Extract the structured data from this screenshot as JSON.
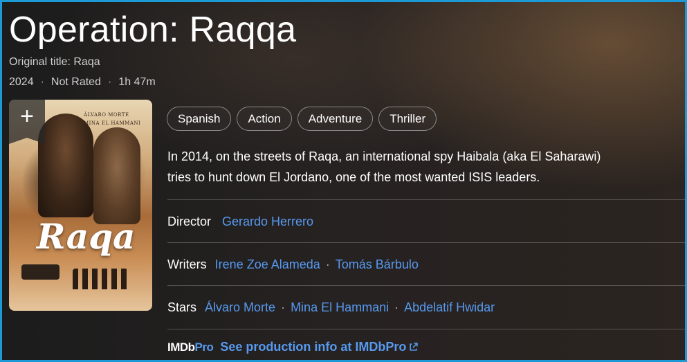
{
  "title": "Operation: Raqqa",
  "original_title": "Original title: Raqa",
  "meta": {
    "year": "2024",
    "rating": "Not Rated",
    "runtime": "1h 47m",
    "separator": "·"
  },
  "poster": {
    "logo_text": "Raqa",
    "credits": [
      "ÁLVARO MORTE",
      "MINA EL HAMMANI"
    ],
    "add_symbol": "+"
  },
  "genres": [
    "Spanish",
    "Action",
    "Adventure",
    "Thriller"
  ],
  "plot": {
    "line1": "In 2014, on the streets of Raqa, an international spy Haibala (aka El Saharawi)",
    "line2": "tries to hunt down El Jordano, one of the most wanted ISIS leaders."
  },
  "credits": {
    "director": {
      "label": "Director",
      "names": [
        "Gerardo Herrero"
      ]
    },
    "writers": {
      "label": "Writers",
      "names": [
        "Irene Zoe Alameda",
        "Tomás Bárbulo"
      ]
    },
    "stars": {
      "label": "Stars",
      "names": [
        "Álvaro Morte",
        "Mina El Hammani",
        "Abdelatif Hwidar"
      ]
    }
  },
  "imdbpro": {
    "logo_imdb": "IMDb",
    "logo_pro": "Pro",
    "link": "See production info at IMDbPro"
  },
  "colors": {
    "link": "#5799ef",
    "border": "#1b9ad6"
  }
}
